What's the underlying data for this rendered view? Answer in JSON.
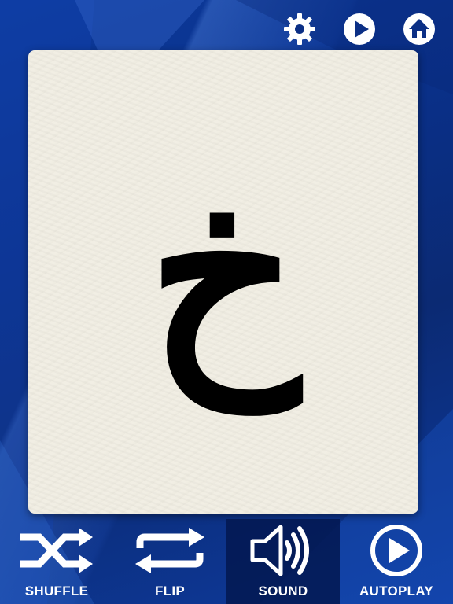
{
  "card": {
    "letter": "خ"
  },
  "top_bar": {
    "icons": [
      "gear-icon",
      "play-icon",
      "home-icon"
    ]
  },
  "bottom_bar": {
    "shuffle_label": "SHUFFLE",
    "flip_label": "FLIP",
    "sound_label": "SOUND",
    "autoplay_label": "AUTOPLAY",
    "active": "sound"
  },
  "colors": {
    "background": "#0a2f86",
    "card": "#f1eee3",
    "letter": "#000000",
    "icon": "#ffffff"
  }
}
